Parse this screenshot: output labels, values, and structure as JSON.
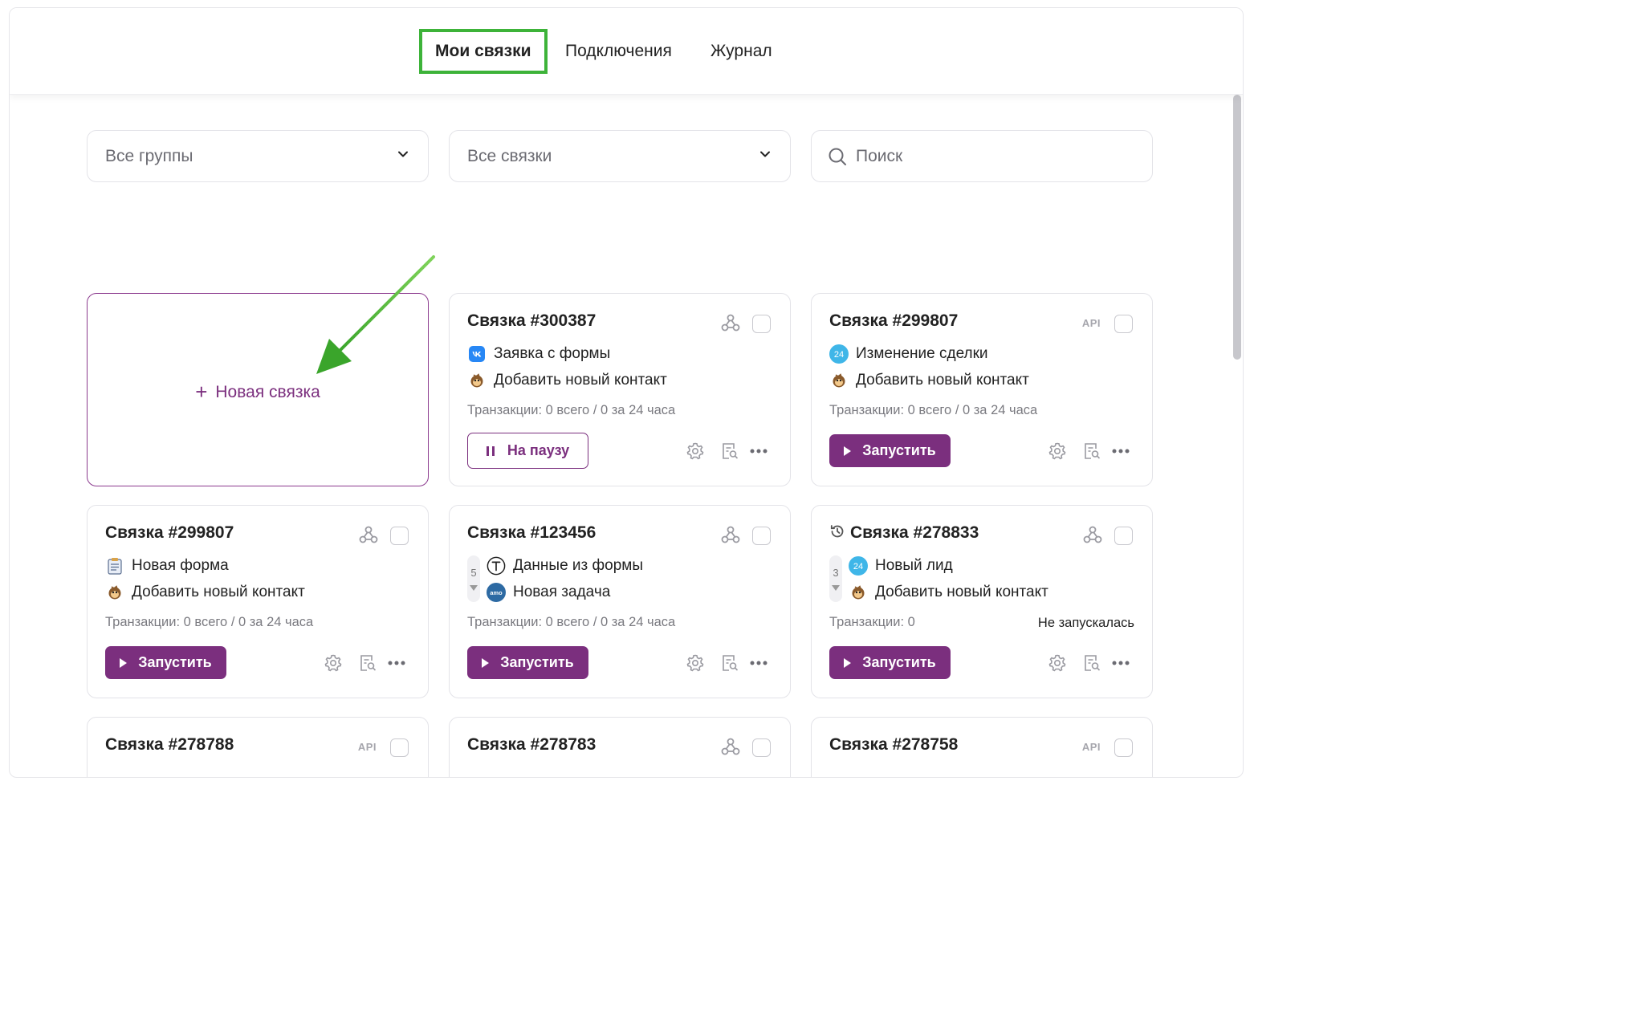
{
  "tabs": [
    {
      "label": "Мои связки"
    },
    {
      "label": "Подключения"
    },
    {
      "label": "Журнал"
    }
  ],
  "filters": {
    "groups": "Все группы",
    "links": "Все связки",
    "search_placeholder": "Поиск"
  },
  "new_card": {
    "label": "Новая связка"
  },
  "buttons": {
    "run": "Запустить",
    "pause": "На паузу"
  },
  "badges": {
    "api": "API"
  },
  "cards": [
    {
      "title": "Связка #300387",
      "trigger": "Заявка с формы",
      "action": "Добавить новый контакт",
      "tx": "Транзакции: 0 всего / 0 за 24 часа"
    },
    {
      "title": "Связка #299807",
      "trigger": "Изменение сделки",
      "action": "Добавить новый контакт",
      "tx": "Транзакции: 0 всего / 0 за 24 часа"
    },
    {
      "title": "Связка #299807",
      "trigger": "Новая форма",
      "action": "Добавить новый контакт",
      "tx": "Транзакции: 0 всего / 0 за 24 часа"
    },
    {
      "title": "Связка #123456",
      "counter": "5",
      "trigger": "Данные из формы",
      "action": "Новая задача",
      "tx": "Транзакции: 0 всего / 0 за 24 часа"
    },
    {
      "title": "Связка #278833",
      "counter": "3",
      "trigger": "Новый лид",
      "action": "Добавить новый контакт",
      "tx": "Транзакции: 0",
      "status": "Не запускалась"
    },
    {
      "title": "Связка #278788"
    },
    {
      "title": "Связка #278783"
    },
    {
      "title": "Связка #278758"
    }
  ],
  "icon_labels": {
    "b24": "24",
    "amo": "amo"
  },
  "colors": {
    "accent": "#7b2f7e",
    "highlight": "#3db339",
    "vk": "#2787f5",
    "b24": "#3fb6e8",
    "amo": "#2d6aa3"
  }
}
